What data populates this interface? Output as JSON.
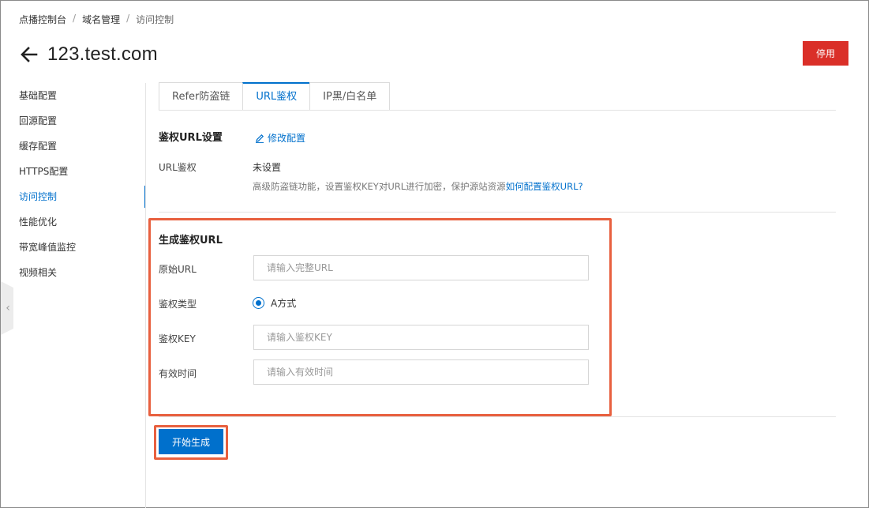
{
  "breadcrumb": {
    "items": [
      "点播控制台",
      "域名管理",
      "访问控制"
    ],
    "separator": "/"
  },
  "header": {
    "title": "123.test.com",
    "disable_label": "停用"
  },
  "sidebar": {
    "items": [
      {
        "label": "基础配置"
      },
      {
        "label": "回源配置"
      },
      {
        "label": "缓存配置"
      },
      {
        "label": "HTTPS配置"
      },
      {
        "label": "访问控制"
      },
      {
        "label": "性能优化"
      },
      {
        "label": "带宽峰值监控"
      },
      {
        "label": "视频相关"
      }
    ],
    "active_index": 4
  },
  "tabs": [
    {
      "label": "Refer防盗链"
    },
    {
      "label": "URL鉴权"
    },
    {
      "label": "IP黑/白名单"
    }
  ],
  "auth_section": {
    "title": "鉴权URL设置",
    "edit_label": "修改配置",
    "field_label": "URL鉴权",
    "field_value": "未设置",
    "help_text": "高级防盗链功能，设置鉴权KEY对URL进行加密，保护源站资源",
    "help_link": "如何配置鉴权URL?"
  },
  "generate": {
    "title": "生成鉴权URL",
    "original_url": {
      "label": "原始URL",
      "placeholder": "请输入完整URL"
    },
    "auth_type": {
      "label": "鉴权类型",
      "option": "A方式"
    },
    "auth_key": {
      "label": "鉴权KEY",
      "placeholder": "请输入鉴权KEY"
    },
    "valid_time": {
      "label": "有效时间",
      "placeholder": "请输入有效时间"
    },
    "start_label": "开始生成"
  },
  "colors": {
    "accent": "#0070cc",
    "danger": "#da2f28",
    "highlight": "#e8603f"
  },
  "icons": [
    "arrow-left-icon",
    "pencil-icon",
    "chevron-left-icon"
  ]
}
